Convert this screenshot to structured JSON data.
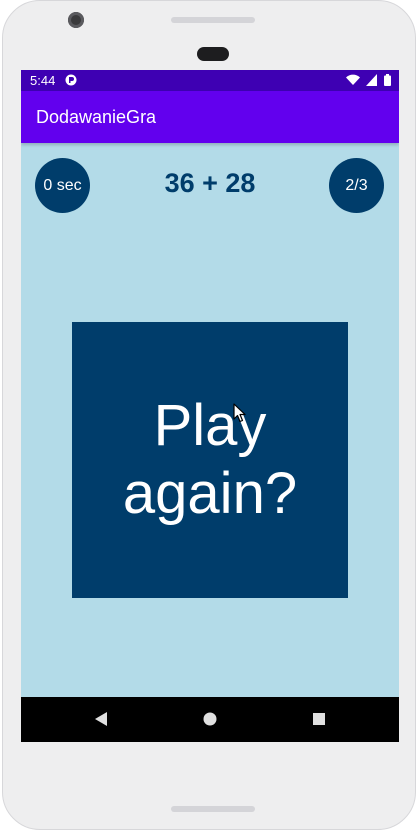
{
  "status_bar": {
    "time": "5:44",
    "color": "#3e00b3",
    "icons": [
      "app-notification-icon",
      "wifi-icon",
      "cell-signal-icon",
      "battery-icon"
    ]
  },
  "app_bar": {
    "title": "DodawanieGra",
    "color": "#6200ee"
  },
  "game": {
    "timer_label": "0 sec",
    "question": "36 + 28",
    "score_label": "2/3",
    "play_again_label": "Play again?",
    "accent_color": "#003d6b",
    "background_color": "#b3dbe8"
  },
  "nav_bar": {
    "buttons": [
      "back-icon",
      "home-icon",
      "recents-icon"
    ]
  }
}
